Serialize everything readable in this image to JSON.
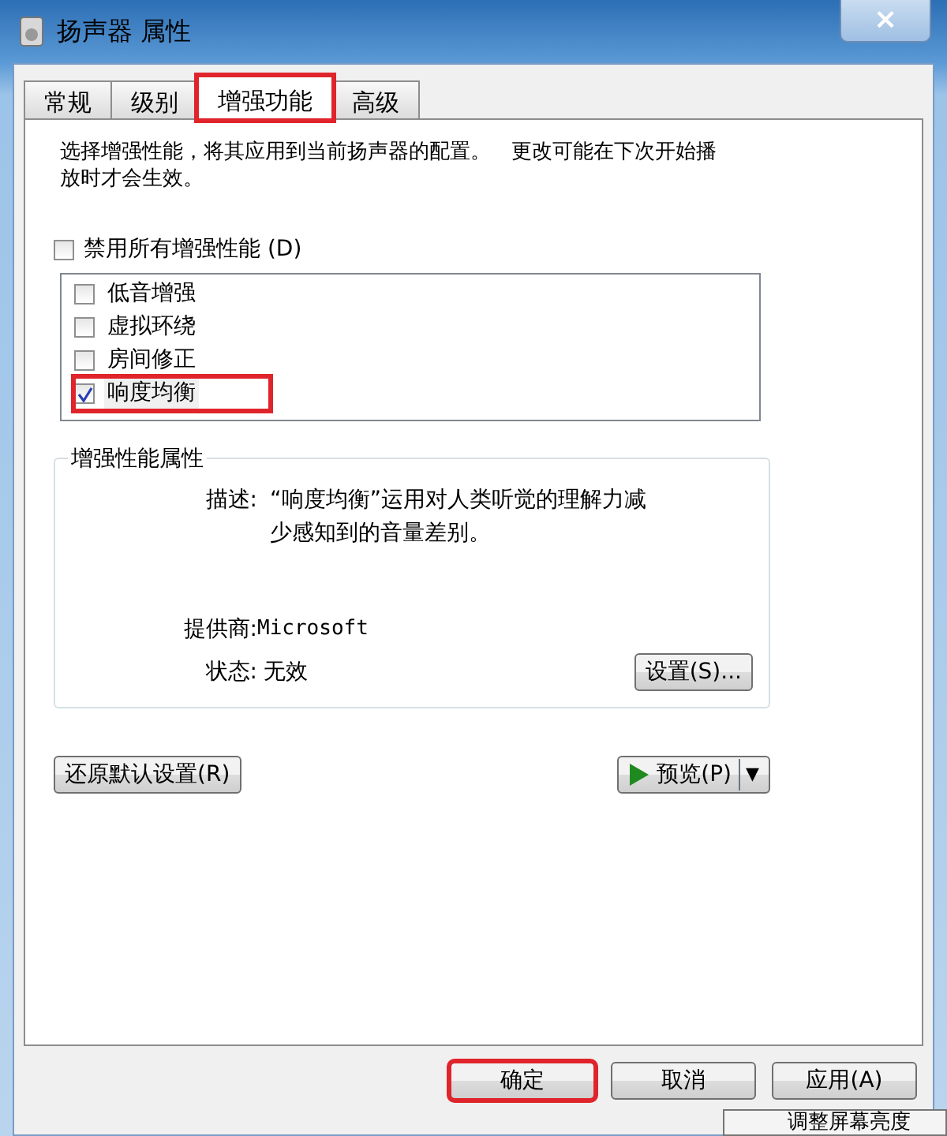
{
  "window": {
    "title": "扬声器 属性",
    "close": "×"
  },
  "tabs": [
    {
      "label": "常规",
      "selected": false,
      "highlighted": false
    },
    {
      "label": "级别",
      "selected": false,
      "highlighted": false
    },
    {
      "label": "增强功能",
      "selected": true,
      "highlighted": true
    },
    {
      "label": "高级",
      "selected": false,
      "highlighted": false
    }
  ],
  "intro": "选择增强性能，将其应用到当前扬声器的配置。　更改可能在下次开始播放时才会生效。",
  "disable_all": {
    "label": "禁用所有增强性能 (D)",
    "checked": false
  },
  "enhancements": [
    {
      "label": "低音增强",
      "checked": false,
      "selected": false,
      "highlighted": false
    },
    {
      "label": "虚拟环绕",
      "checked": false,
      "selected": false,
      "highlighted": false
    },
    {
      "label": "房间修正",
      "checked": false,
      "selected": false,
      "highlighted": false
    },
    {
      "label": "响度均衡",
      "checked": true,
      "selected": true,
      "highlighted": true
    }
  ],
  "properties": {
    "title": "增强性能属性",
    "description_label": "描述:",
    "description": "“响度均衡”运用对人类听觉的理解力减少感知到的音量差别。",
    "provider_label": "提供商:",
    "provider": "Microsoft",
    "status_label": "状态:",
    "status": "无效",
    "settings_button": "设置(S)..."
  },
  "restore_button": "还原默认设置(R)",
  "preview_button": {
    "label": "预览(P)",
    "arrow": "▼"
  },
  "buttons": [
    {
      "label": "确定",
      "highlighted": true
    },
    {
      "label": "取消",
      "highlighted": false
    },
    {
      "label": "应用(A)",
      "highlighted": false
    }
  ],
  "tooltip": "调整屏幕亮度"
}
